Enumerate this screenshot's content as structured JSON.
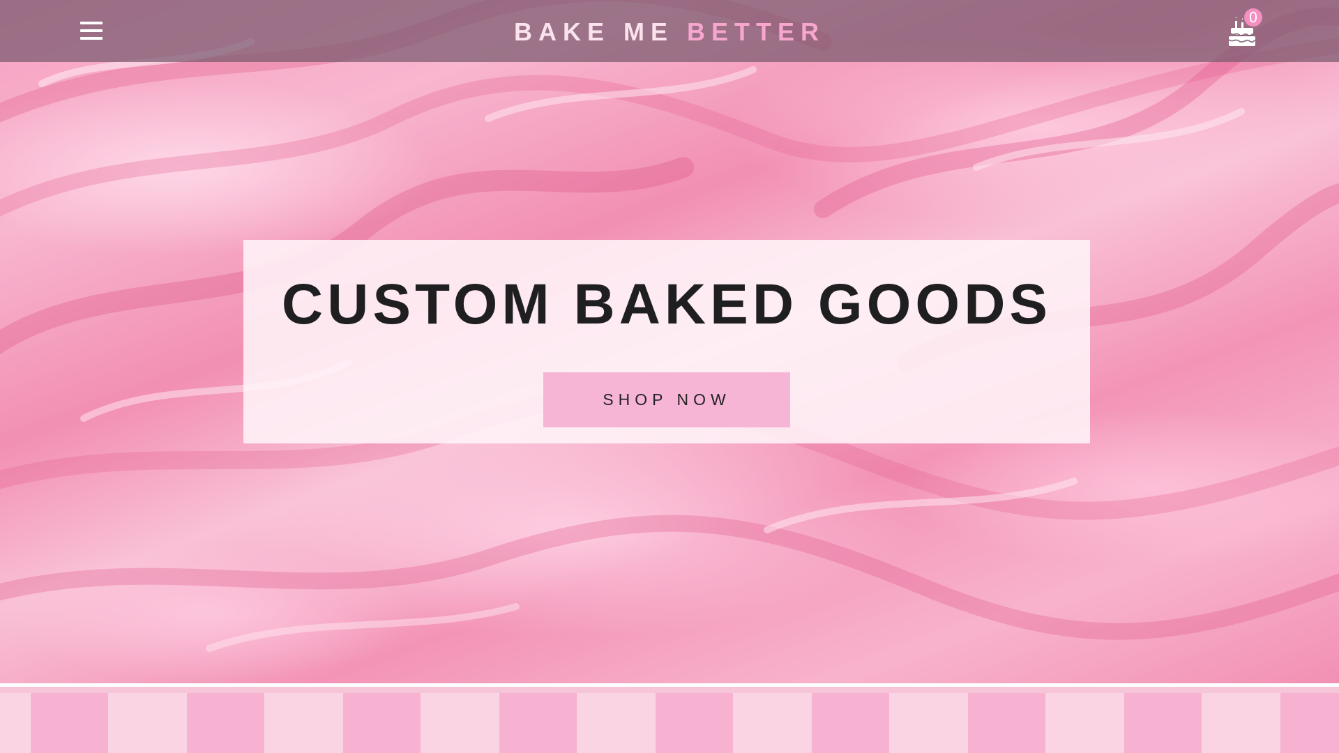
{
  "header": {
    "brand_part1": "BAKE ME",
    "brand_part2": "BETTER",
    "cart_count": "0",
    "icons": {
      "menu": "hamburger-menu-icon",
      "cart": "birthday-cake-icon"
    }
  },
  "hero": {
    "headline": "CUSTOM BAKED GOODS",
    "cta_label": "SHOP NOW"
  },
  "colors": {
    "brand_light": "#fbe3ee",
    "brand_accent": "#f7a6cd",
    "button_bg": "#f7b5d6",
    "stripe_light": "#fbd4e3",
    "stripe_dark": "#f7b1d1"
  }
}
